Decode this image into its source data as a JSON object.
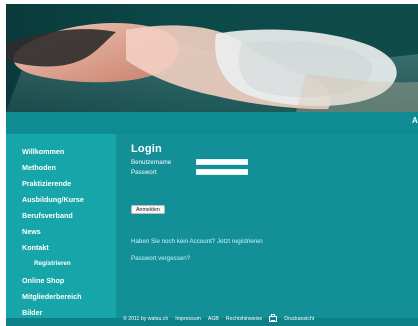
{
  "header": {
    "right_text": "A"
  },
  "sidebar": {
    "items": [
      {
        "label": "Willkommen",
        "sub": false
      },
      {
        "label": "Methoden",
        "sub": false
      },
      {
        "label": "Praktizierende",
        "sub": false
      },
      {
        "label": "Ausbildung/Kurse",
        "sub": false
      },
      {
        "label": "Berufsverband",
        "sub": false
      },
      {
        "label": "News",
        "sub": false
      },
      {
        "label": "Kontakt",
        "sub": false
      },
      {
        "label": "Registrieren",
        "sub": true
      },
      {
        "label": "Online Shop",
        "sub": false
      },
      {
        "label": "Mitgliederbereich",
        "sub": false
      },
      {
        "label": "Bilder",
        "sub": false
      }
    ]
  },
  "main": {
    "title": "Login",
    "username_label": "Benutzername",
    "password_label": "Passwort",
    "username_value": "",
    "password_value": "",
    "submit_label": "Anmelden",
    "register_text": "Haben Sie noch kein Account? Jetzt registrieren",
    "forgot_text": "Passwort vergessen?"
  },
  "footer": {
    "copyright": "© 2011 by watsu.ch",
    "links": [
      "Impressum",
      "AGB",
      "Rechtshinweise",
      "Druckansicht"
    ]
  },
  "colors": {
    "page_bg": "#ffffff",
    "teal_main": "#138f98",
    "teal_sidebar": "#16a6a9",
    "teal_header": "#0b3e3f",
    "link": "#c9f6ff"
  },
  "icons": {
    "print": "printer-icon"
  }
}
